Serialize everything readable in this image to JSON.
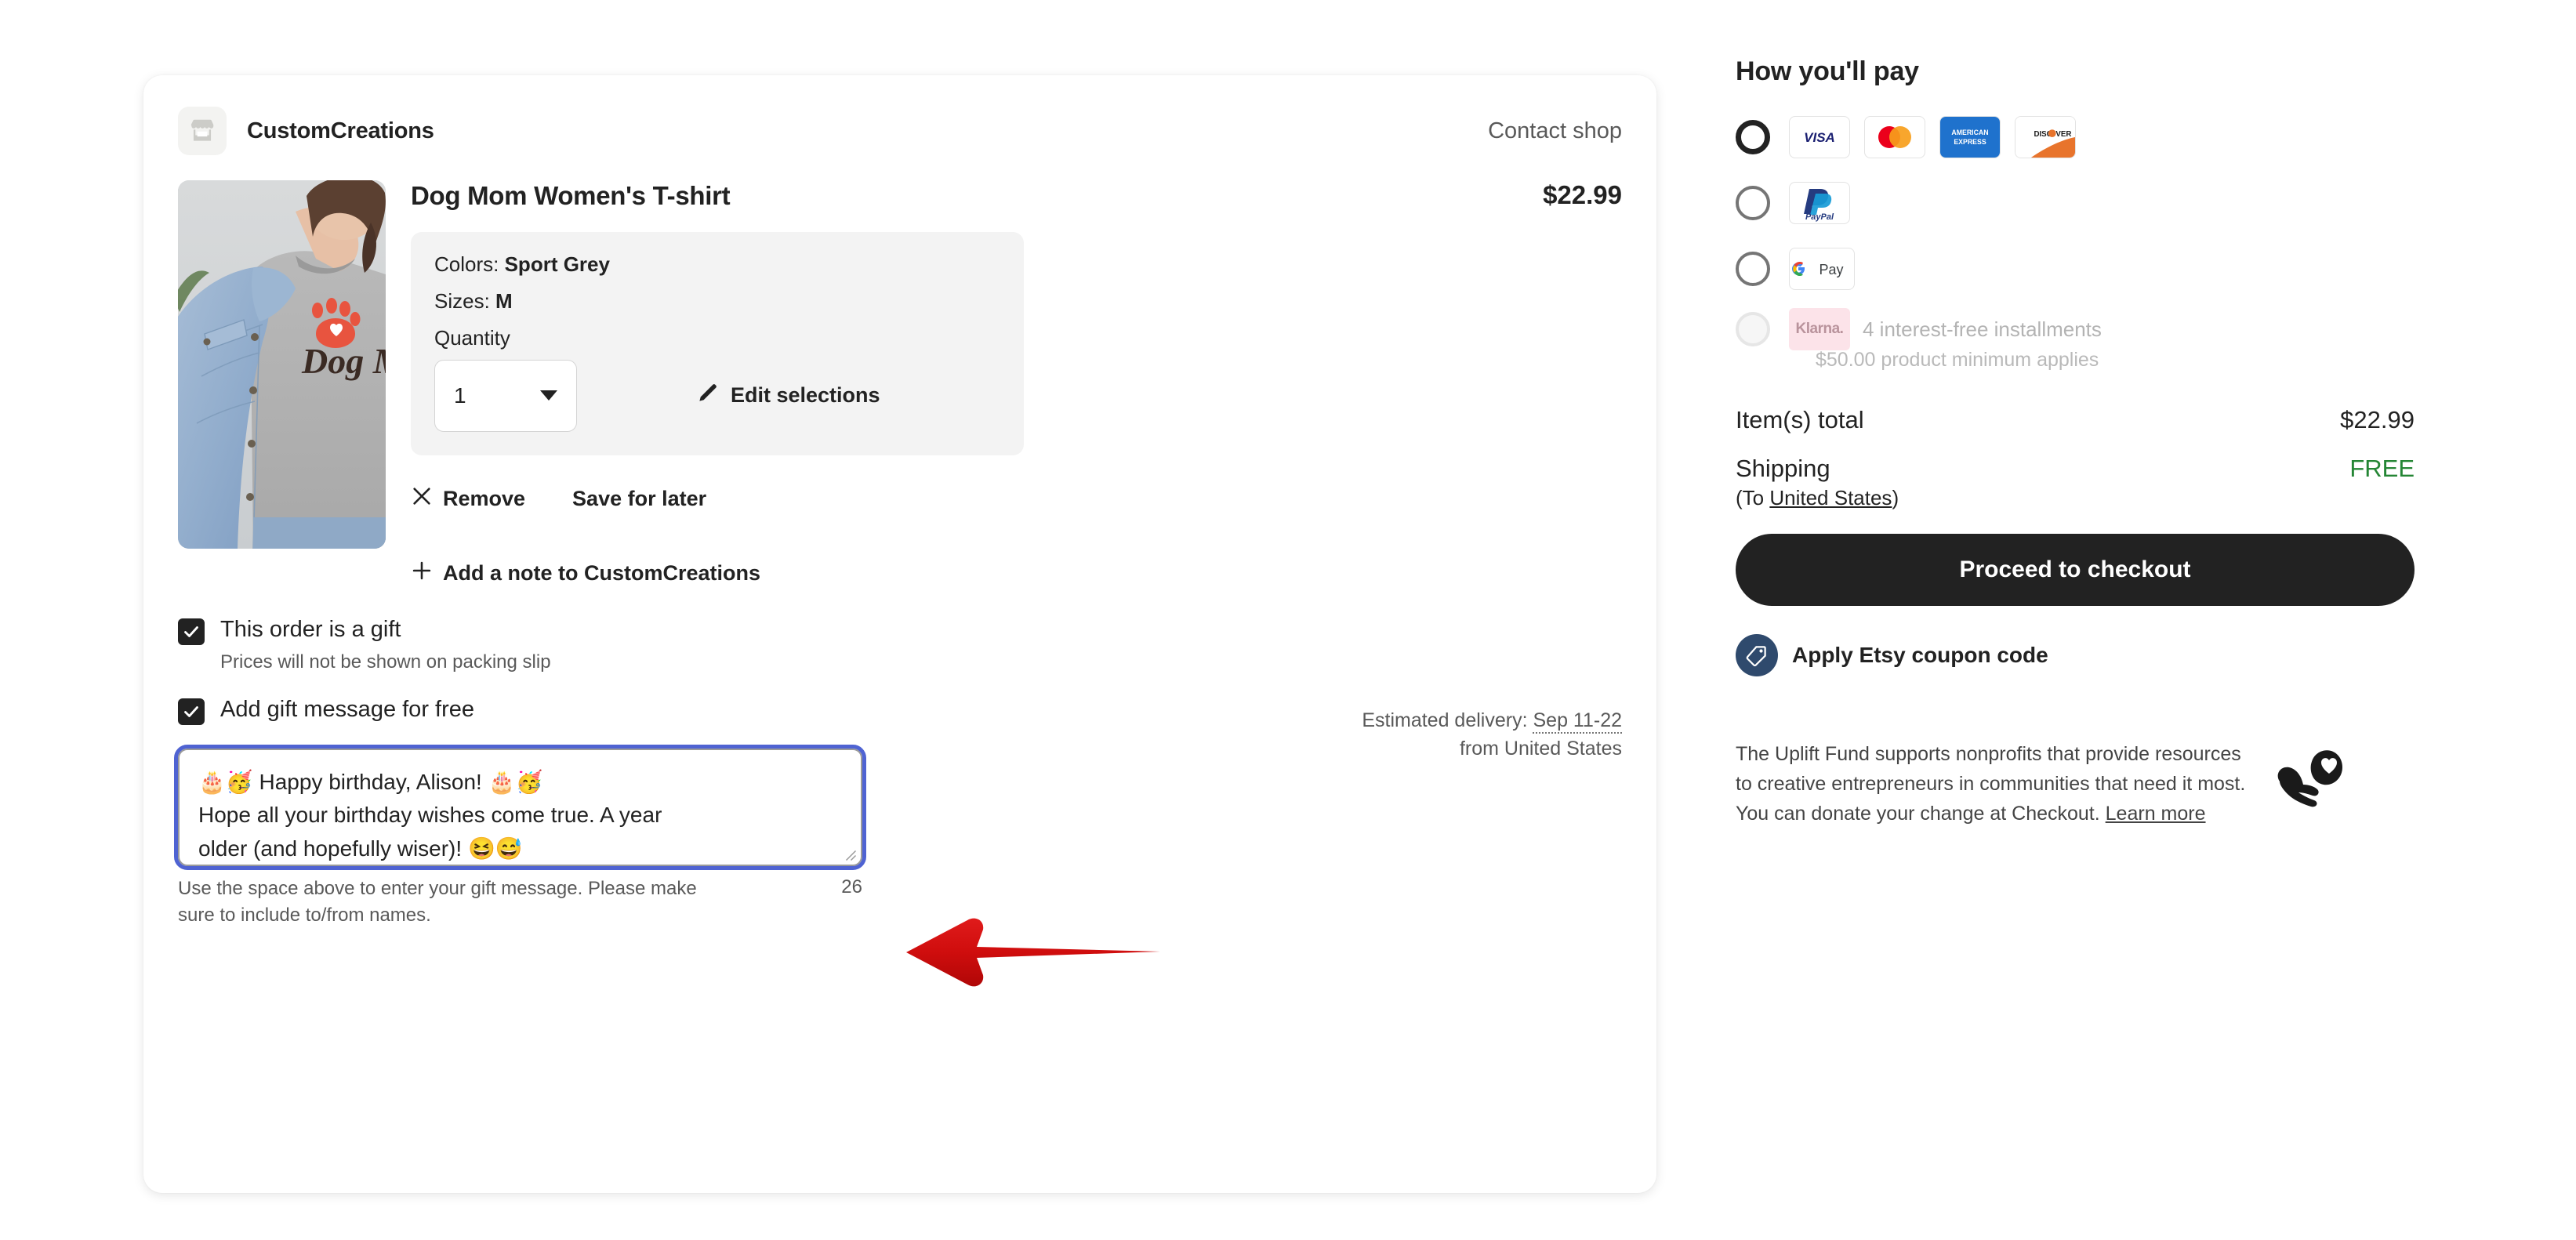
{
  "shop": {
    "icon": "storefront-icon",
    "name": "CustomCreations",
    "contact_label": "Contact shop"
  },
  "product": {
    "title": "Dog Mom Women's T-shirt",
    "price": "$22.99",
    "image_alt": "Woman wearing grey Dog Mom t-shirt with denim jacket",
    "variations": {
      "colors_label": "Colors:",
      "colors_value": "Sport Grey",
      "sizes_label": "Sizes:",
      "sizes_value": "M",
      "quantity_label": "Quantity",
      "quantity_value": "1",
      "edit_label": "Edit selections",
      "edit_icon": "pencil-icon"
    },
    "actions": {
      "remove_label": "Remove",
      "remove_icon": "close-x-icon",
      "save_label": "Save for later"
    },
    "note_label": "Add a note to CustomCreations",
    "note_icon": "plus-icon",
    "delivery_prefix": "Estimated delivery:",
    "delivery_date": "Sep 11-22",
    "delivery_from": "from United States"
  },
  "gift": {
    "is_gift_label": "This order is a gift",
    "is_gift_sub": "Prices will not be shown on packing slip",
    "is_gift_checked": true,
    "add_message_label": "Add gift message for free",
    "add_message_checked": true,
    "message_lines": [
      "🎂🥳 Happy birthday, Alison! 🎂🥳",
      "Hope all your birthday wishes come true. A year",
      "older (and hopefully wiser)! 😆😅"
    ],
    "helper_text": "Use the space above to enter your gift message. Please make sure to include to/from names.",
    "char_count": "26"
  },
  "payment": {
    "heading": "How you'll pay",
    "options": [
      {
        "id": "credit-card",
        "selected": true,
        "cards": [
          "visa-logo",
          "mastercard-logo",
          "amex-logo",
          "discover-logo"
        ]
      },
      {
        "id": "paypal",
        "selected": false,
        "cards": [
          "paypal-logo"
        ]
      },
      {
        "id": "google-pay",
        "selected": false,
        "cards": [
          "google-pay-logo"
        ]
      },
      {
        "id": "klarna",
        "selected": false,
        "disabled": true,
        "badge": "Klarna.",
        "label": "4 interest-free installments",
        "note": "$50.00 product minimum applies"
      }
    ]
  },
  "summary": {
    "items_total_label": "Item(s) total",
    "items_total_value": "$22.99",
    "shipping_label": "Shipping",
    "shipping_value": "FREE",
    "shipping_value_color": "#258635",
    "ship_to_prefix": "(To ",
    "ship_to_country": "United States",
    "ship_to_suffix": ")",
    "checkout_label": "Proceed to checkout",
    "coupon_label": "Apply Etsy coupon code",
    "coupon_icon": "tag-icon"
  },
  "uplift": {
    "text": "The Uplift Fund supports nonprofits that provide resources to creative entrepreneurs in communities that need it most. You can donate your change at Checkout. ",
    "link_label": "Learn more",
    "icon": "hand-heart-icon"
  },
  "annotation": {
    "arrow_icon": "left-arrow-annotation",
    "arrow_color": "#cc0000"
  }
}
